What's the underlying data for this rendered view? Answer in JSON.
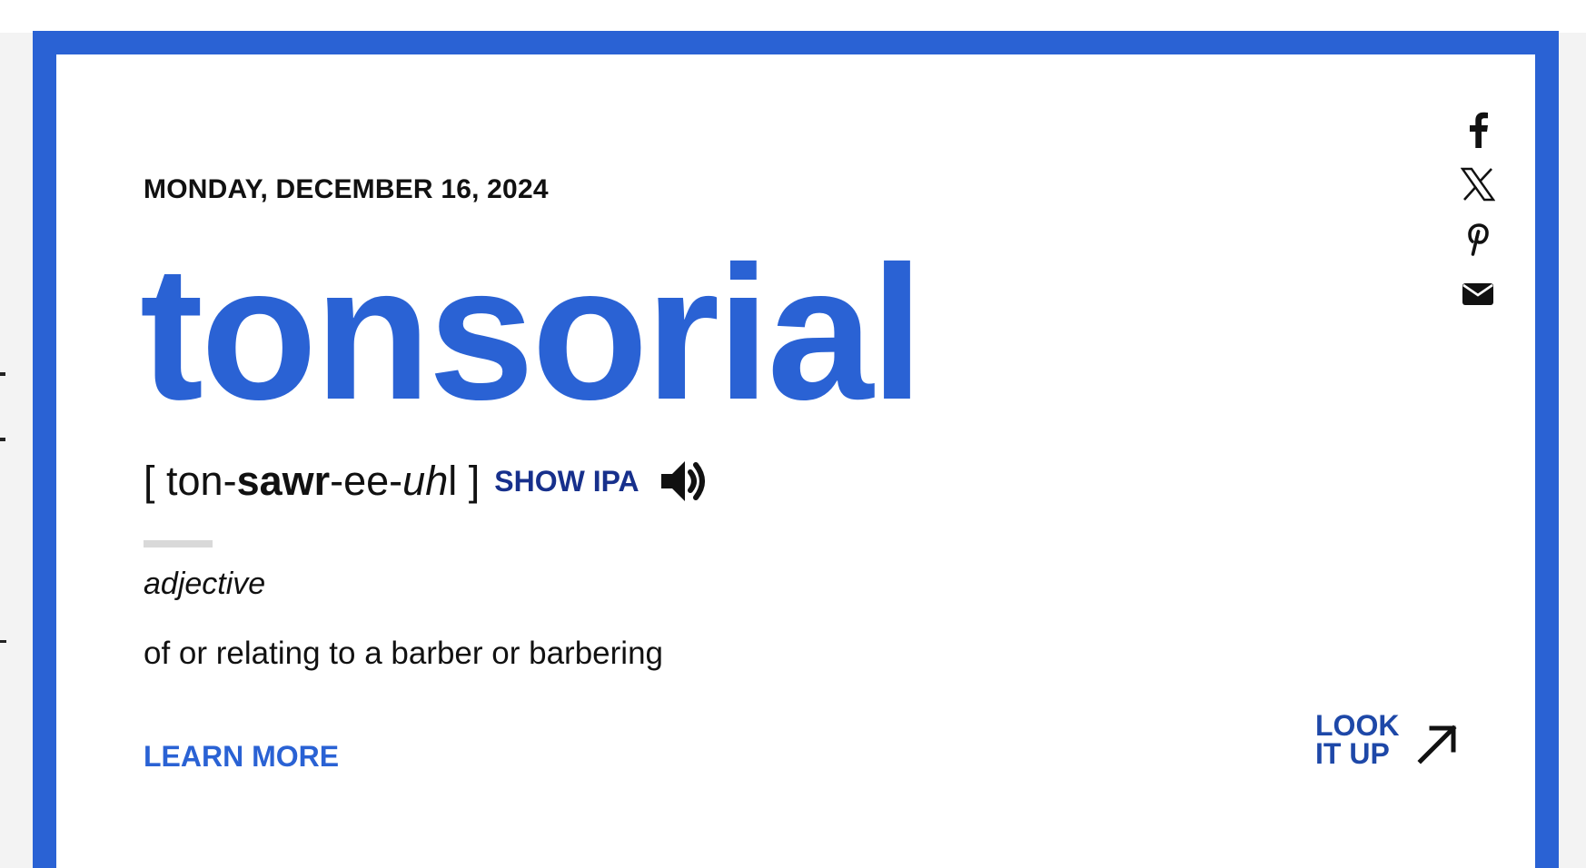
{
  "colors": {
    "brand_blue": "#2a62d4",
    "ipa_navy": "#17308c",
    "look_it_up_blue": "#1e48a8",
    "text": "#111111",
    "divider_gray": "#d9d9d9"
  },
  "word_of_day": {
    "date": "MONDAY, DECEMBER 16, 2024",
    "word": "tonsorial",
    "pronunciation": {
      "open_bracket": "[ ",
      "part1": "ton-",
      "stressed": "sawr",
      "part2": "-ee-",
      "italic": "uh",
      "part3": "l",
      "close_bracket": " ]"
    },
    "show_ipa_label": "SHOW IPA",
    "audio_icon": "speaker-icon",
    "part_of_speech": "adjective",
    "definition": "of or relating to a barber or barbering",
    "learn_more_label": "LEARN MORE",
    "look_it_up_line1": "LOOK",
    "look_it_up_line2": "IT UP",
    "look_it_up_icon": "arrow-up-right-icon"
  },
  "share": {
    "icons": [
      "facebook-icon",
      "x-icon",
      "pinterest-icon",
      "email-icon"
    ]
  }
}
